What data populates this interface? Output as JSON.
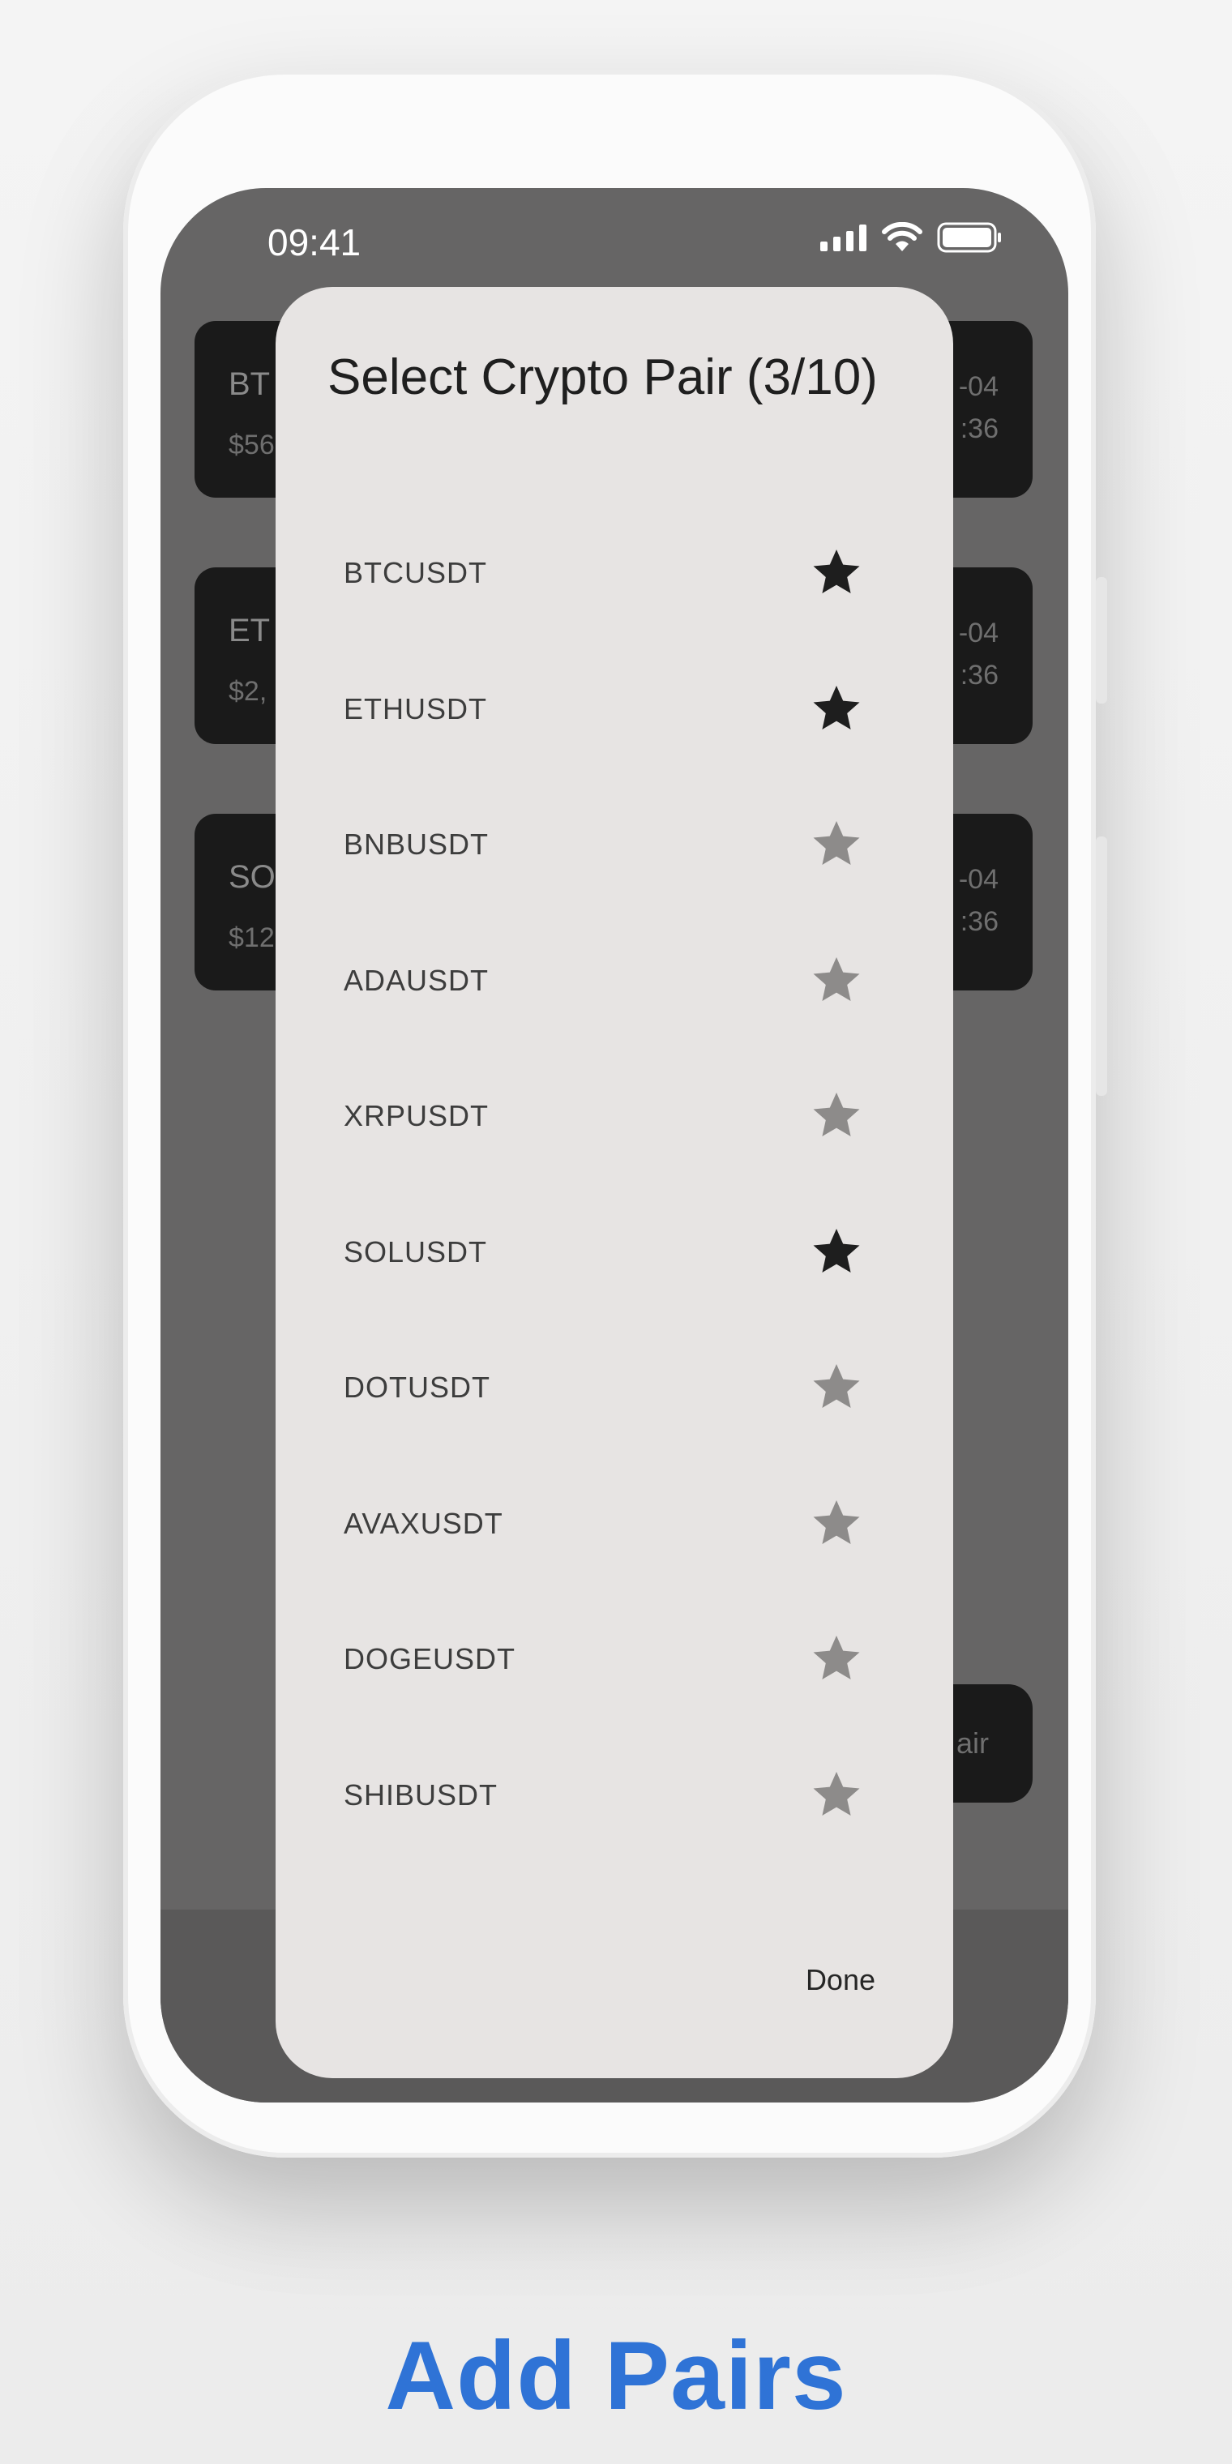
{
  "status_bar": {
    "time": "09:41"
  },
  "background_cards": [
    {
      "symbol": "BT",
      "price": "$56",
      "date": "-04",
      "time": ":36"
    },
    {
      "symbol": "ET",
      "price": "$2,",
      "date": "-04",
      "time": ":36"
    },
    {
      "symbol": "SO",
      "price": "$12",
      "date": "-04",
      "time": ":36"
    }
  ],
  "background_fab": {
    "label": "air"
  },
  "dialog": {
    "title": "Select Crypto Pair (3/10)",
    "pairs": [
      {
        "label": "BTCUSDT",
        "selected": true
      },
      {
        "label": "ETHUSDT",
        "selected": true
      },
      {
        "label": "BNBUSDT",
        "selected": false
      },
      {
        "label": "ADAUSDT",
        "selected": false
      },
      {
        "label": "XRPUSDT",
        "selected": false
      },
      {
        "label": "SOLUSDT",
        "selected": true
      },
      {
        "label": "DOTUSDT",
        "selected": false
      },
      {
        "label": "AVAXUSDT",
        "selected": false
      },
      {
        "label": "DOGEUSDT",
        "selected": false
      },
      {
        "label": "SHIBUSDT",
        "selected": false
      }
    ],
    "done_label": "Done",
    "star_icon": "star-icon"
  },
  "caption": "Add Pairs",
  "colors": {
    "caption": "#2f73d6",
    "star_selected": "#1e1e1e",
    "star_unselected": "#8d8b8a",
    "dialog_bg": "#e7e4e3"
  }
}
